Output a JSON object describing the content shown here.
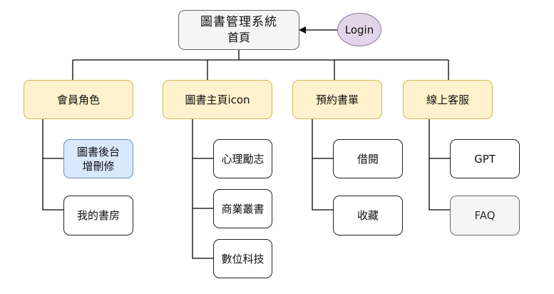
{
  "root": {
    "title": "圖書管理系統",
    "subtitle": "首頁"
  },
  "login": "Login",
  "categories": [
    {
      "label": "會員角色",
      "children": [
        "圖書後台\n增刪修",
        "我的書房"
      ]
    },
    {
      "label": "圖書主頁icon",
      "children": [
        "心理勵志",
        "商業叢書",
        "數位科技"
      ]
    },
    {
      "label": "預約書單",
      "children": [
        "借閱",
        "收藏"
      ]
    },
    {
      "label": "線上客服",
      "children": [
        "GPT",
        "FAQ"
      ]
    }
  ],
  "colors": {
    "category_fill": "#fff2cc",
    "category_stroke": "#d6b656",
    "admin_fill": "#dae8fc",
    "admin_stroke": "#6c8ebf",
    "login_fill": "#e1d5e7",
    "login_stroke": "#9673a6",
    "root_fill": "#f5f5f5",
    "faq_fill": "#f5f5f5",
    "line": "#000000"
  }
}
